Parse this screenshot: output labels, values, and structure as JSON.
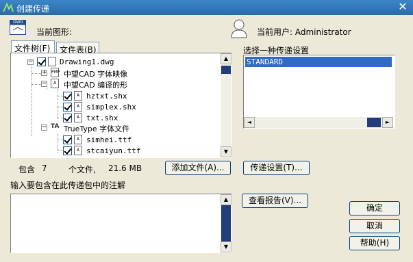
{
  "window": {
    "title": "创建传递"
  },
  "drawing": {
    "label": "当前图形:",
    "icon_text": "DWG"
  },
  "user": {
    "label": "当前用户: Administrator"
  },
  "tabs": [
    {
      "label": "文件树(F)"
    },
    {
      "label": "文件表(B)"
    }
  ],
  "tree": {
    "root": "Drawing1.dwg",
    "fontmap_group": "中望CAD 字体映像",
    "compiled_group": "中望CAD 编译的形",
    "compiled_files": [
      "hztxt.shx",
      "simplex.shx",
      "txt.shx"
    ],
    "truetype_group": "TrueType 字体文件",
    "truetype_files": [
      "simhei.ttf",
      "stcaiyun.ttf"
    ]
  },
  "summary": {
    "prefix": "包含",
    "count": "7",
    "unit": "个文件,",
    "size": "21.6 MB"
  },
  "buttons": {
    "add_file": "添加文件(A)...",
    "transmittal_setup": "传递设置(T)...",
    "view_report": "查看报告(V)...",
    "ok": "确定",
    "cancel": "取消",
    "help": "帮助(H)"
  },
  "setup": {
    "label": "选择一种传递设置",
    "selected": "STANDARD"
  },
  "notes": {
    "label": "输入要包含在此传递包中的注解",
    "value": ""
  }
}
